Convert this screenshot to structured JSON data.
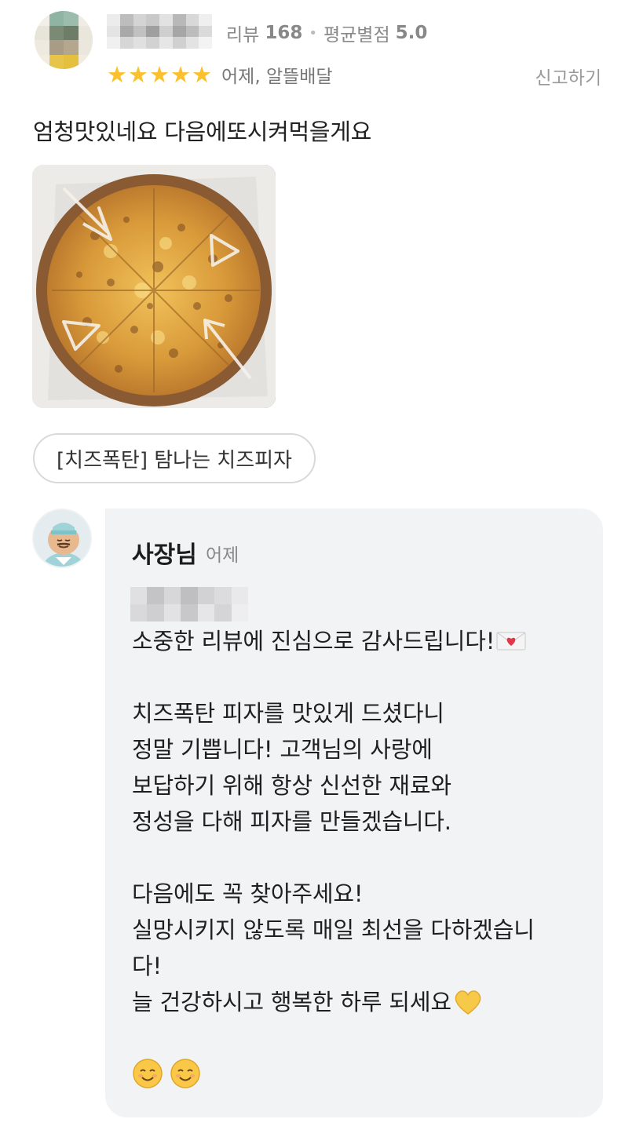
{
  "reviewer": {
    "review_count_label": "리뷰",
    "review_count": "168",
    "avg_rating_label": "평균별점",
    "avg_rating": "5.0",
    "stars": 5,
    "star_glyph": "★",
    "date": "어제",
    "order_type": "알뜰배달",
    "report_label": "신고하기",
    "avatar_icon": "blurred-profile-photo"
  },
  "review": {
    "text": "엄청맛있네요 다음에또시켜먹을게요",
    "photo": "cheese-pizza-in-box-photo",
    "menu_chip": "[치즈폭탄] 탐나는 치즈피자"
  },
  "reply": {
    "author": "사장님",
    "date": "어제",
    "lines": [
      "소중한 리뷰에 진심으로 감사드립니다!",
      "치즈폭탄 피자를 맛있게 드셨다니",
      "정말 기쁩니다! 고객님의 사랑에",
      "보답하기 위해 항상 신선한 재료와",
      "정성을 다해 피자를 만들겠습니다.",
      "다음에도 꼭 찾아주세요!",
      "실망시키지 않도록 매일 최선을 다하겠습니",
      "다!",
      "늘 건강하시고 행복한 하루 되세요"
    ],
    "icons": [
      "love-letter-icon",
      "yellow-heart-icon",
      "smiling-face-icon",
      "smiling-face-icon"
    ]
  },
  "colors": {
    "star": "#fbc02d",
    "bubble": "#f2f3f5",
    "muted_text": "#888888"
  }
}
